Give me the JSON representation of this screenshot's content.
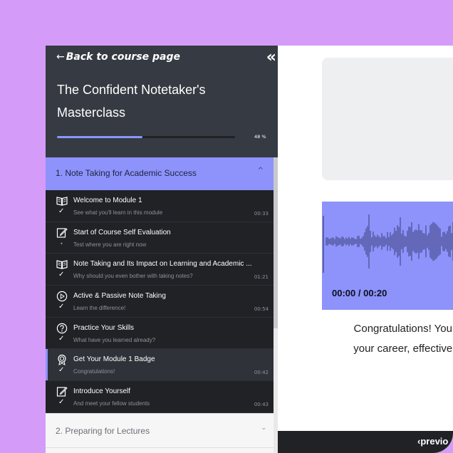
{
  "sidebar": {
    "back_label": "Back to course page",
    "back_arrow": "←",
    "collapse_icon": "«",
    "course_title": "The Confident Notetaker's Masterclass",
    "progress_percent": 48,
    "progress_text": "48 %",
    "module1": {
      "label": "1. Note Taking for Academic Success",
      "chevron": "^"
    },
    "lessons": [
      {
        "title": "Welcome to Module 1",
        "subtitle": "See what you'll learn in this module",
        "duration": "00:33",
        "icon": "book-icon",
        "status": "✓"
      },
      {
        "title": "Start of Course Self Evaluation",
        "subtitle": "Test where you are right now",
        "duration": "",
        "icon": "edit-icon",
        "status": "•"
      },
      {
        "title": "Note Taking and Its Impact on Learning and Academic ...",
        "subtitle": "Why should you even bother with taking notes?",
        "duration": "01:21",
        "icon": "book-icon",
        "status": "✓"
      },
      {
        "title": "Active & Passive Note Taking",
        "subtitle": "Learn the difference!",
        "duration": "00:54",
        "icon": "play-icon",
        "status": "✓"
      },
      {
        "title": "Practice Your Skills",
        "subtitle": "What have you learned already?",
        "duration": "",
        "icon": "question-icon",
        "status": "✓"
      },
      {
        "title": "Get Your Module 1 Badge",
        "subtitle": "Congratulations!",
        "duration": "00:42",
        "icon": "badge-icon",
        "status": "✓"
      },
      {
        "title": "Introduce Yourself",
        "subtitle": "And meet your fellow students",
        "duration": "00:43",
        "icon": "edit-icon",
        "status": "✓"
      }
    ],
    "module2": {
      "label": "2. Preparing for Lectures",
      "chevron": "⌄"
    }
  },
  "main": {
    "audio_time": "00:00 / 00:20",
    "congrats_line1": "Congratulations! You e",
    "congrats_line2": "your career, effective n",
    "prev_label": "previo",
    "prev_arrow": "‹"
  },
  "colors": {
    "background": "#d49cf8",
    "accent": "#8d93fb",
    "sidebar_dark": "#202226",
    "sidebar_head": "#363a42"
  }
}
